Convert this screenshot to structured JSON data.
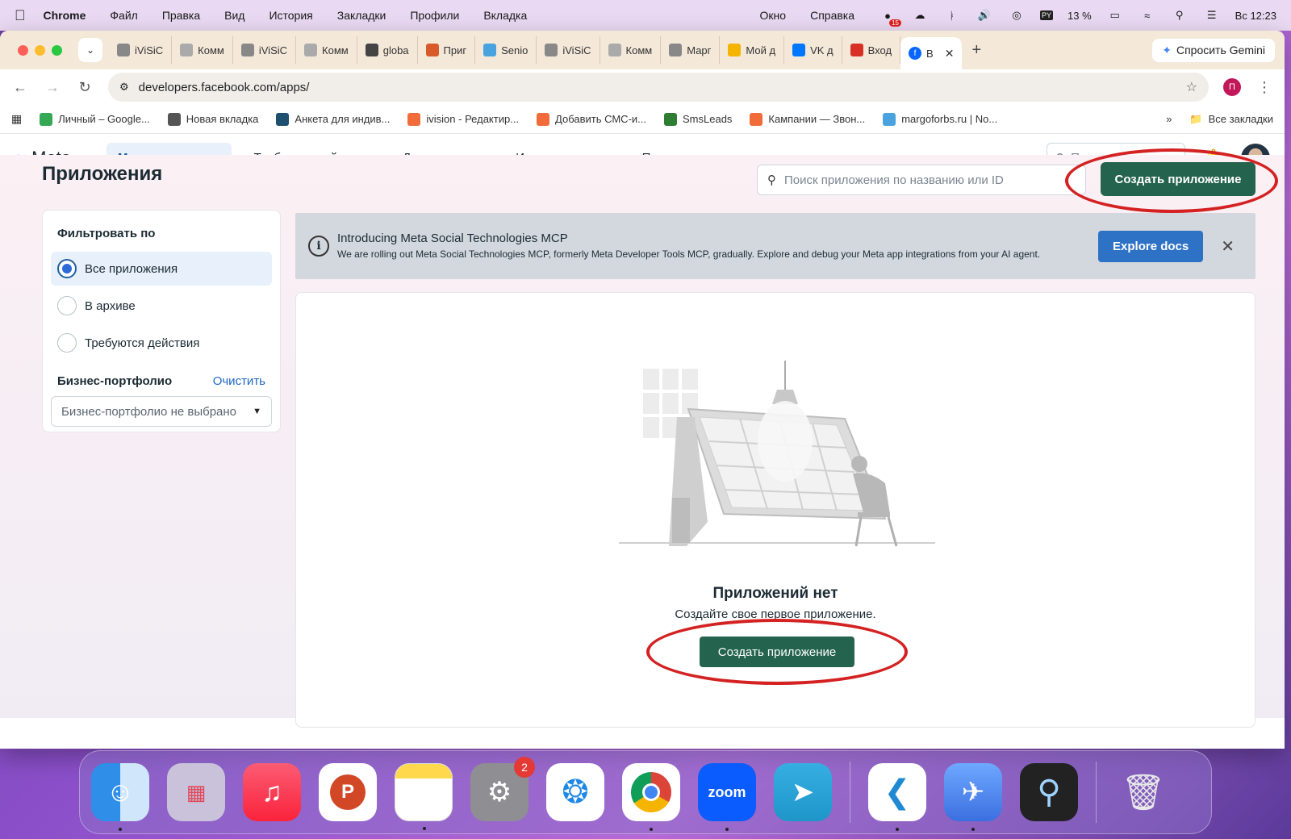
{
  "menubar": {
    "app": "Chrome",
    "items": [
      "Файл",
      "Правка",
      "Вид",
      "История",
      "Закладки",
      "Профили",
      "Вкладка"
    ],
    "right_items": [
      "Окно",
      "Справка"
    ],
    "badge": "15",
    "pv": "PY",
    "battery": "13 %",
    "clock": "Вс 12:23"
  },
  "browser": {
    "tabs": [
      {
        "label": "iViSiC",
        "color": "#888"
      },
      {
        "label": "Комм",
        "color": "#aaa"
      },
      {
        "label": "iViSiC",
        "color": "#888"
      },
      {
        "label": "Комм",
        "color": "#aaa"
      },
      {
        "label": "globa",
        "color": "#444"
      },
      {
        "label": "Приг",
        "color": "#d85a2b"
      },
      {
        "label": "Senio",
        "color": "#4aa3df"
      },
      {
        "label": "iViSiC",
        "color": "#888"
      },
      {
        "label": "Комм",
        "color": "#aaa"
      },
      {
        "label": "Марг",
        "color": "#888"
      },
      {
        "label": "Мой д",
        "color": "#f4b400"
      },
      {
        "label": "VK д",
        "color": "#0077ff"
      },
      {
        "label": "Вход",
        "color": "#d93025"
      }
    ],
    "active_tab": "В",
    "gemini": "Спросить Gemini",
    "url": "developers.facebook.com/apps/",
    "profile_letter": "П",
    "bookmarks": [
      {
        "label": "Личный – Google...",
        "color": "#34a853"
      },
      {
        "label": "Новая вкладка",
        "color": "#555"
      },
      {
        "label": "Анкета для индив...",
        "color": "#1d4f6e"
      },
      {
        "label": "ivision - Редактир...",
        "color": "#f26b3a"
      },
      {
        "label": "Добавить СМС-и...",
        "color": "#f26b3a"
      },
      {
        "label": "SmsLeads",
        "color": "#2e7d32"
      },
      {
        "label": "Кампании — Звон...",
        "color": "#f26b3a"
      },
      {
        "label": "margoforbs.ru | No...",
        "color": "#4aa3df"
      }
    ],
    "all_bookmarks": "Все закладки"
  },
  "meta": {
    "logo": "Meta",
    "nav": [
      {
        "label": "Мои приложения",
        "active": true,
        "dropdown": false
      },
      {
        "label": "Требуются действия",
        "active": false,
        "dropdown": false
      },
      {
        "label": "Документы",
        "active": false,
        "dropdown": true
      },
      {
        "label": "Инструменты",
        "active": false,
        "dropdown": true
      },
      {
        "label": "Поддержка",
        "active": false,
        "dropdown": true
      }
    ],
    "search_placeholder": "Поиск..."
  },
  "page": {
    "title": "Приложения",
    "app_search_placeholder": "Поиск приложения по названию или ID",
    "create_button": "Создать приложение",
    "filter": {
      "title": "Фильтровать по",
      "options": [
        {
          "label": "Все приложения",
          "selected": true
        },
        {
          "label": "В архиве",
          "selected": false
        },
        {
          "label": "Требуются действия",
          "selected": false
        }
      ],
      "portfolio_title": "Бизнес-портфолио",
      "clear": "Очистить",
      "portfolio_select": "Бизнес-портфолио не выбрано"
    },
    "banner": {
      "title": "Introducing Meta Social Technologies MCP",
      "body": "We are rolling out Meta Social Technologies MCP, formerly Meta Developer Tools MCP, gradually. Explore and debug your Meta app integrations from your AI agent.",
      "button": "Explore docs"
    },
    "empty": {
      "title": "Приложений нет",
      "subtitle": "Создайте свое первое приложение.",
      "button": "Создать приложение"
    }
  },
  "dock": {
    "settings_badge": "2",
    "zoom_label": "zoom",
    "powerpoint_label": "P"
  }
}
